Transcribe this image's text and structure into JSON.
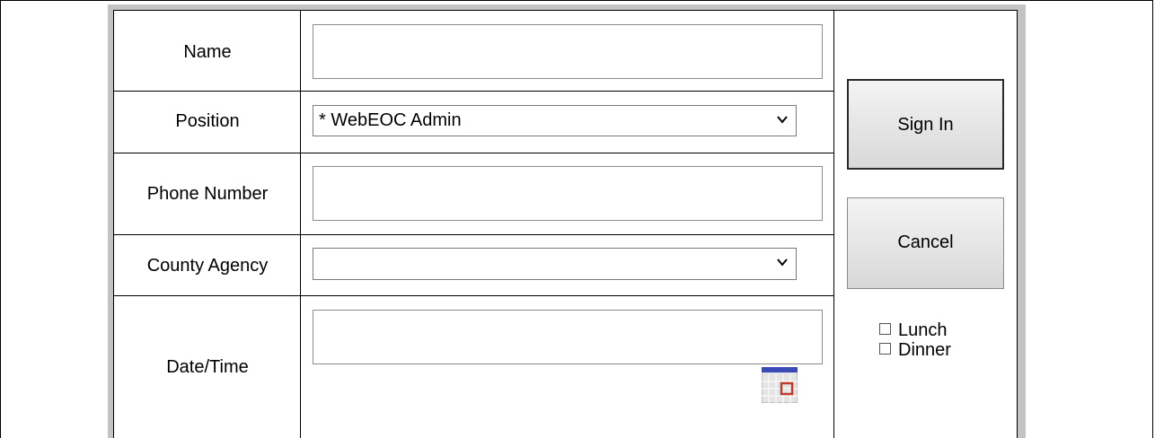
{
  "form": {
    "name": {
      "label": "Name",
      "value": ""
    },
    "position": {
      "label": "Position",
      "selected": "* WebEOC Admin"
    },
    "phone": {
      "label": "Phone Number",
      "value": ""
    },
    "agency": {
      "label": "County Agency",
      "selected": ""
    },
    "datetime": {
      "label": "Date/Time",
      "value": ""
    }
  },
  "actions": {
    "signin_label": "Sign In",
    "cancel_label": "Cancel"
  },
  "meals": {
    "lunch_label": "Lunch",
    "dinner_label": "Dinner",
    "lunch_checked": false,
    "dinner_checked": false
  },
  "icons": {
    "chevron": "chevron-down-icon",
    "calendar": "calendar-icon"
  }
}
